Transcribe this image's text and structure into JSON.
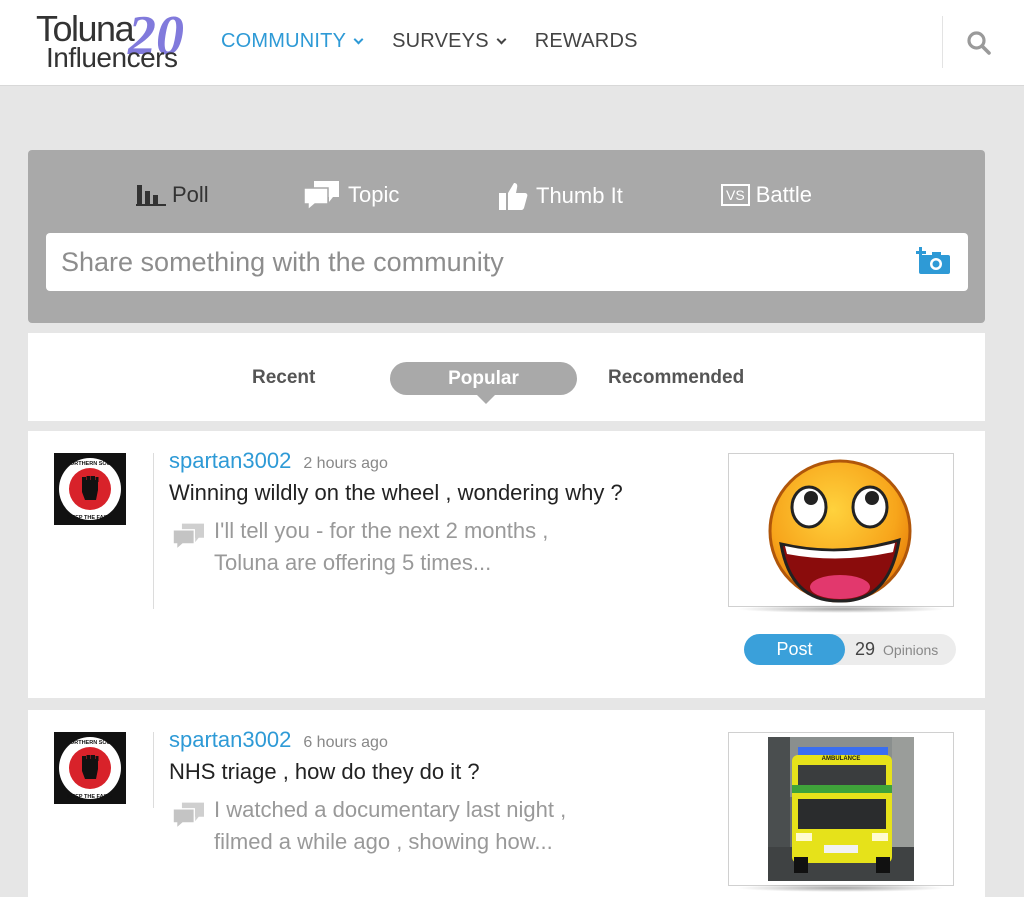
{
  "header": {
    "logo_word1": "Toluna",
    "logo_word2": "Influencers",
    "logo_badge": "20",
    "nav": [
      {
        "label": "COMMUNITY",
        "active": true,
        "has_dropdown": true
      },
      {
        "label": "SURVEYS",
        "active": false,
        "has_dropdown": true
      },
      {
        "label": "REWARDS",
        "active": false,
        "has_dropdown": false
      }
    ],
    "search_icon": "search-icon"
  },
  "composer": {
    "types": [
      {
        "label": "Poll",
        "icon": "poll-bar-chart-icon"
      },
      {
        "label": "Topic",
        "icon": "speech-bubbles-icon"
      },
      {
        "label": "Thumb It",
        "icon": "thumbs-up-icon"
      },
      {
        "label": "Battle",
        "icon": "vs-icon",
        "icon_text": "VS"
      }
    ],
    "placeholder": "Share something with the community",
    "camera_icon": "add-photo-icon"
  },
  "tabs": [
    {
      "label": "Recent",
      "active": false
    },
    {
      "label": "Popular",
      "active": true
    },
    {
      "label": "Recommended",
      "active": false
    }
  ],
  "posts": [
    {
      "author": "spartan3002",
      "time": "2 hours ago",
      "title": "Winning wildly on the wheel , wondering why ?",
      "snippet_line1": "I'll tell you - for the next 2 months ,",
      "snippet_line2": "Toluna are offering 5 times...",
      "post_label": "Post",
      "opinion_count": "29",
      "opinion_label": "Opinions",
      "image": "laughing-smiley-face"
    },
    {
      "author": "spartan3002",
      "time": "6 hours ago",
      "title": "NHS triage , how do they do it ?",
      "snippet_line1": "I watched a documentary last night ,",
      "snippet_line2": "filmed a while ago , showing how...",
      "image": "ambulance-photo",
      "image_text": "AMBULANCE"
    }
  ],
  "avatar_text": {
    "top": "NORTHERN SOUL",
    "bottom": "KEEP THE FAITH"
  },
  "colors": {
    "accent": "#2e9ad6",
    "composer_bg": "#a9a9a9",
    "page_bg": "#e6e6e6",
    "post_button": "#3aa0da"
  }
}
